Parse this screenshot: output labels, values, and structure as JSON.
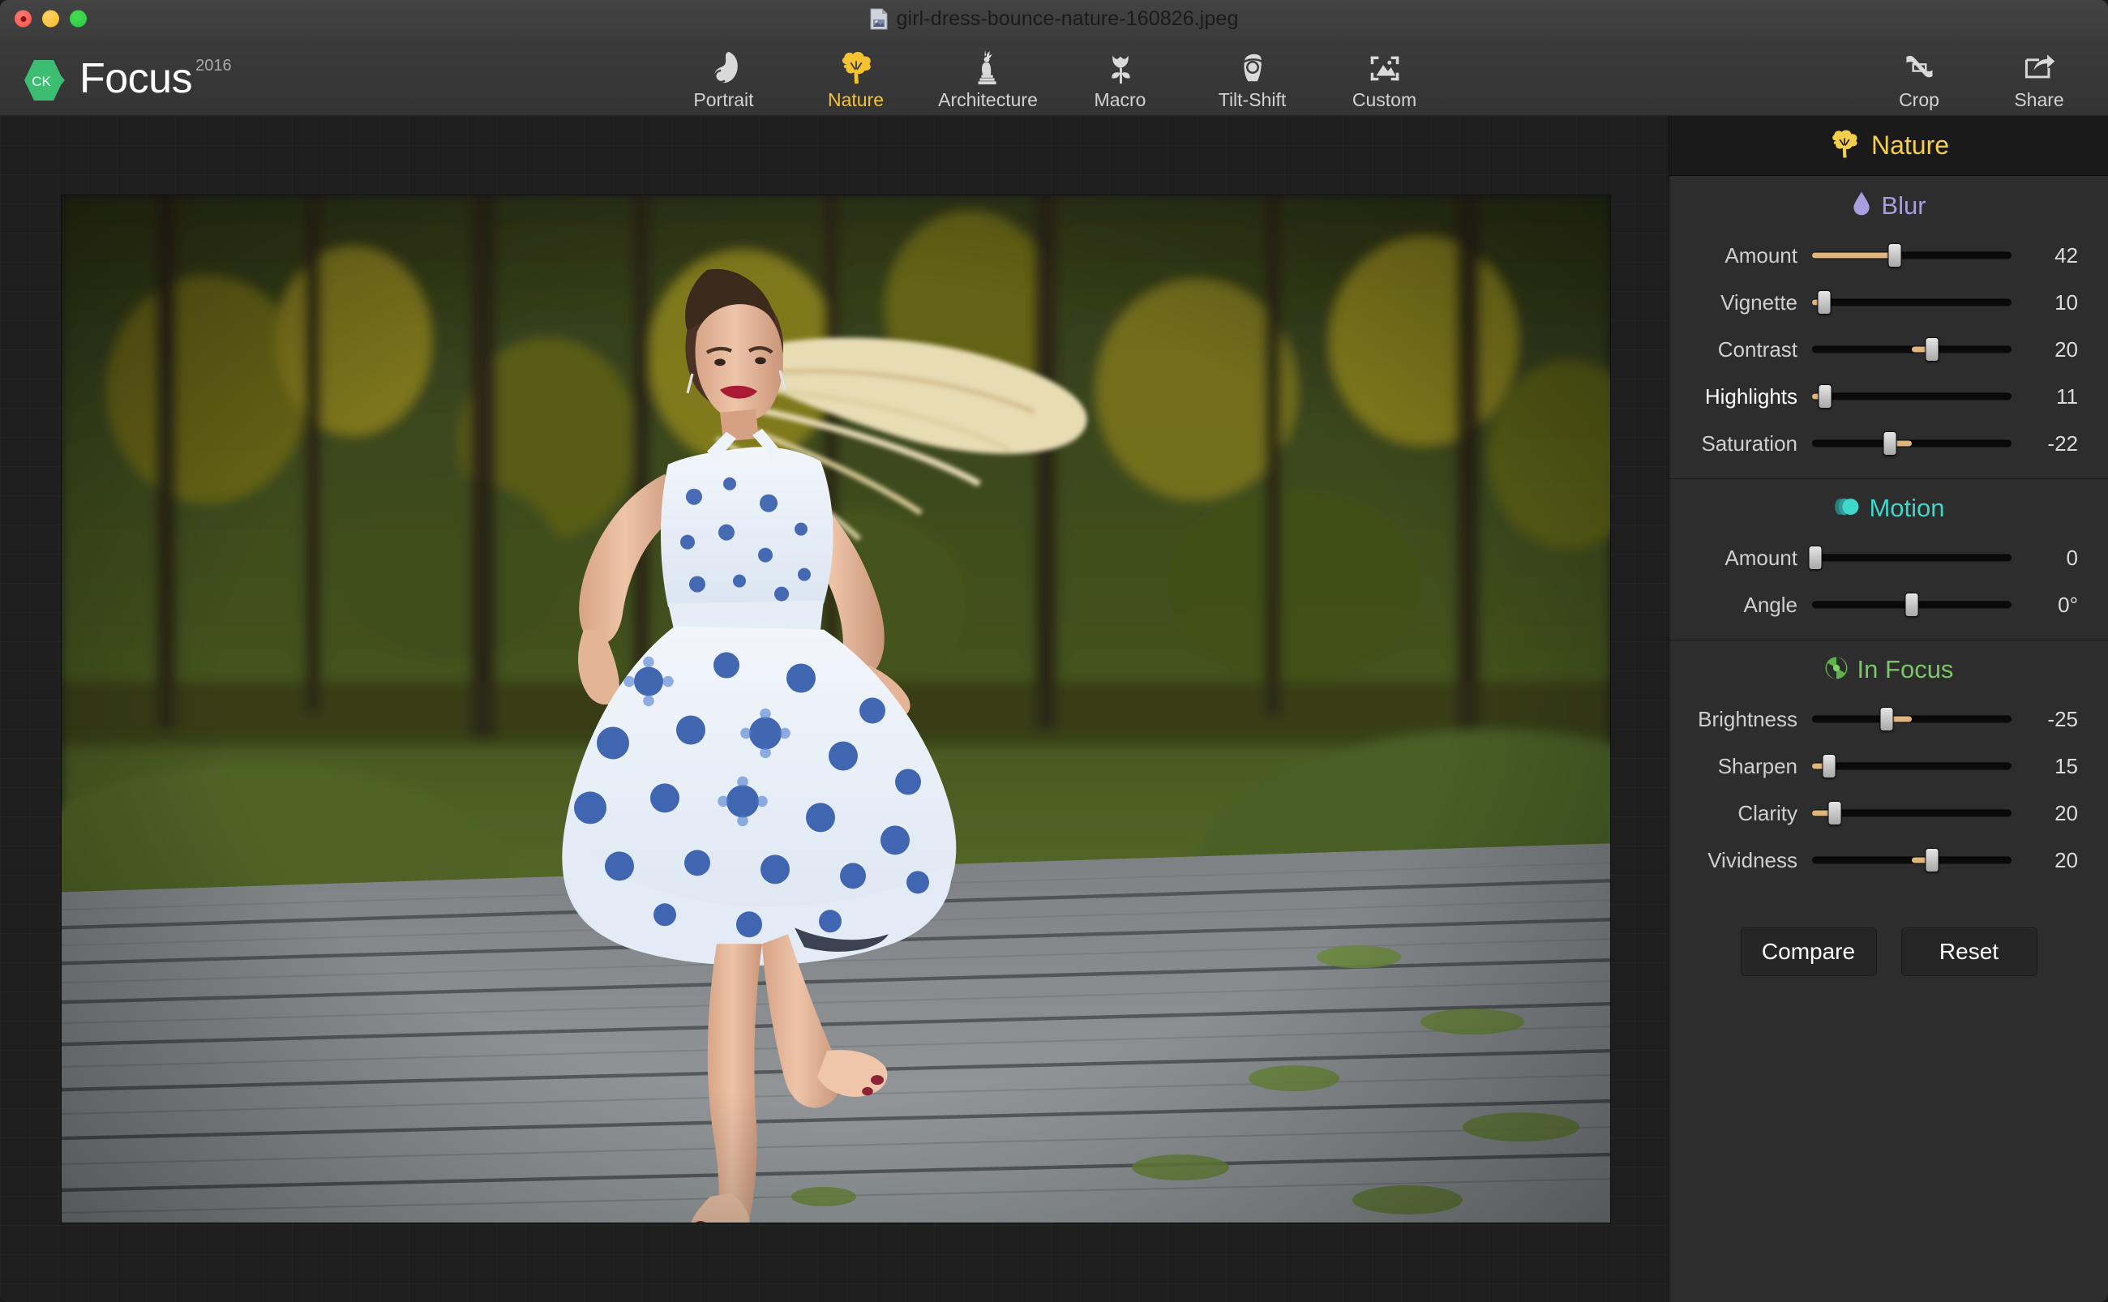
{
  "window": {
    "title": "girl-dress-bounce-nature-160826.jpeg",
    "traffic_lights": [
      "close",
      "minimize",
      "maximize"
    ]
  },
  "brand": {
    "badge": "CK",
    "name": "Focus",
    "year": "2016",
    "accent": "#3cbd72"
  },
  "toolbar": {
    "modes": [
      {
        "label": "Portrait",
        "icon": "portrait-icon",
        "active": false
      },
      {
        "label": "Nature",
        "icon": "tree-icon",
        "active": true
      },
      {
        "label": "Architecture",
        "icon": "statue-icon",
        "active": false
      },
      {
        "label": "Macro",
        "icon": "tulip-icon",
        "active": false
      },
      {
        "label": "Tilt-Shift",
        "icon": "tilt-shift-icon",
        "active": false
      },
      {
        "label": "Custom",
        "icon": "custom-frame-icon",
        "active": false
      }
    ],
    "actions": [
      {
        "label": "Crop",
        "icon": "crop-icon"
      },
      {
        "label": "Share",
        "icon": "share-icon"
      }
    ],
    "active_color": "#f5c331",
    "inactive_color": "#d2d2d2"
  },
  "panel": {
    "header": {
      "title": "Nature",
      "icon": "tree-icon",
      "color": "#f5ce4e"
    },
    "sections": [
      {
        "title": "Blur",
        "icon": "droplet-icon",
        "color": "#a99ee0",
        "sliders": [
          {
            "label": "Amount",
            "value": "42",
            "pct": 42,
            "bold": false
          },
          {
            "label": "Vignette",
            "value": "10",
            "pct": 10,
            "bold": false
          },
          {
            "label": "Contrast",
            "value": "20",
            "pct": 20,
            "bold": false,
            "bipolar": true
          },
          {
            "label": "Highlights",
            "value": "11",
            "pct": 11,
            "bold": true
          },
          {
            "label": "Saturation",
            "value": "-22",
            "pct": -22,
            "bold": false,
            "bipolar": true
          }
        ]
      },
      {
        "title": "Motion",
        "icon": "motion-icon",
        "color": "#3fd6cb",
        "sliders": [
          {
            "label": "Amount",
            "value": "0",
            "pct": 0,
            "bold": false
          },
          {
            "label": "Angle",
            "value": "0°",
            "pct": 0,
            "bold": false,
            "bipolar": true
          }
        ]
      },
      {
        "title": "In Focus",
        "icon": "aperture-icon",
        "color": "#79c765",
        "sliders": [
          {
            "label": "Brightness",
            "value": "-25",
            "pct": -25,
            "bold": false,
            "bipolar": true
          },
          {
            "label": "Sharpen",
            "value": "15",
            "pct": 15,
            "bold": false
          },
          {
            "label": "Clarity",
            "value": "20",
            "pct": 20,
            "bold": false
          },
          {
            "label": "Vividness",
            "value": "20",
            "pct": 20,
            "bold": false,
            "bipolar": true
          }
        ]
      }
    ],
    "footer_buttons": [
      {
        "label": "Compare",
        "name": "compare-button"
      },
      {
        "label": "Reset",
        "name": "reset-button"
      }
    ]
  },
  "canvas": {
    "photo_alt": "girl in blue floral dress bouncing on a wooden boardwalk in a park at sunset",
    "grid_visible": true
  }
}
